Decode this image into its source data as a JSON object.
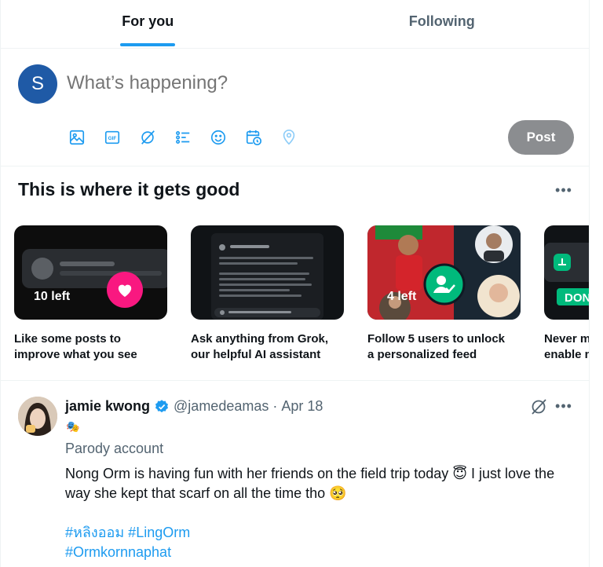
{
  "tabs": [
    {
      "label": "For you",
      "active": true
    },
    {
      "label": "Following",
      "active": false
    }
  ],
  "composer": {
    "avatar_letter": "S",
    "placeholder": "What’s happening?",
    "tools": [
      "image-icon",
      "gif-icon",
      "grok-icon",
      "poll-icon",
      "emoji-icon",
      "schedule-icon",
      "location-icon"
    ],
    "gif_text": "GIF",
    "post_label": "Post"
  },
  "section": {
    "title": "This is where it gets good",
    "more": "•••",
    "cards": [
      {
        "badge": "10 left",
        "title_line1": "Like some posts to",
        "title_line2": "improve what you see"
      },
      {
        "badge": "",
        "title_line1": "Ask anything from Grok,",
        "title_line2": "our helpful AI assistant"
      },
      {
        "badge": "4 left",
        "title_line1": "Follow 5 users to unlock",
        "title_line2": "a personalized feed"
      },
      {
        "badge": "DON",
        "title_line1": "Never m",
        "title_line2": "enable n"
      }
    ]
  },
  "post": {
    "name": "jamie kwong",
    "handle": "@jamedeamas",
    "separator": "·",
    "date": "Apr 18",
    "parody_emoji": "🎭",
    "parody_label": "Parody account",
    "text": "Nong Orm is having fun with her friends on the field trip today 😇 I just love the way she kept that scarf on all the time tho 🥺",
    "hashtags_line1": "#หลิงออม #LingOrm",
    "hashtags_line2": "#Ormkornnaphat",
    "more": "•••"
  },
  "colors": {
    "accent": "#1d9bf0",
    "post_button": "#8b8d90",
    "avatar_bg": "#1f5aa6",
    "text_secondary": "#536471",
    "heart_pink": "#f91880",
    "green": "#00ba7c"
  }
}
